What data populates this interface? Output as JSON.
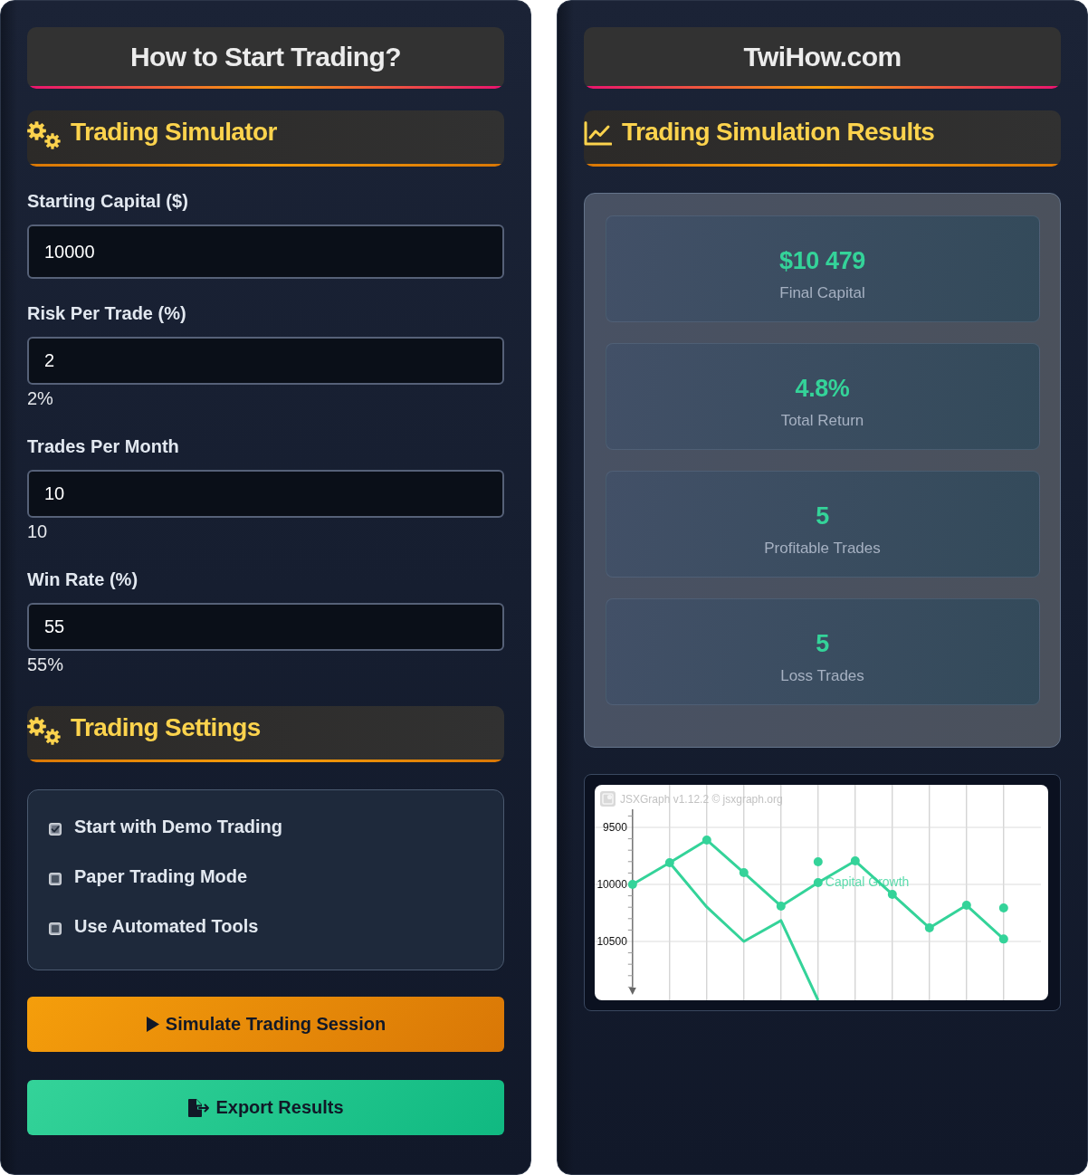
{
  "left_panel": {
    "header": {
      "title": "How to Start Trading?"
    },
    "simulator_section": {
      "title": "Trading Simulator"
    },
    "fields": [
      {
        "label": "Starting Capital ($)",
        "value": "10000"
      },
      {
        "label": "Risk Per Trade (%)",
        "value": "2",
        "reading": "2%"
      },
      {
        "label": "Trades Per Month",
        "value": "10",
        "reading": "10"
      },
      {
        "label": "Win Rate (%)",
        "value": "55",
        "reading": "55%"
      }
    ],
    "settings_section": {
      "title": "Trading Settings"
    },
    "options": [
      {
        "label": "Start with Demo Trading",
        "checked": true
      },
      {
        "label": "Paper Trading Mode",
        "checked": false
      },
      {
        "label": "Use Automated Tools",
        "checked": false
      }
    ],
    "buttons": [
      {
        "kind": "simulate",
        "label": "Simulate Trading Session"
      },
      {
        "kind": "export",
        "label": "Export Results"
      }
    ]
  },
  "right_panel": {
    "header": {
      "title": "TwiHow.com"
    },
    "results_section": {
      "title": "Trading Simulation Results"
    },
    "stats": [
      {
        "value": "$10 479",
        "label": "Final Capital"
      },
      {
        "value": "4.8%",
        "label": "Total Return"
      },
      {
        "value": "5",
        "label": "Profitable Trades"
      },
      {
        "value": "5",
        "label": "Loss Trades"
      }
    ],
    "chart": {
      "credit": "JSXGraph v1.12.2 © jsxgraph.org",
      "chart_data": {
        "type": "line",
        "grid": true,
        "categories": [
          null,
          null,
          null,
          null,
          null,
          null,
          null,
          null,
          null,
          null,
          null
        ],
        "ylim": [
          11016,
          9127
        ],
        "yticks": [
          9500,
          10000,
          10500
        ],
        "series": [
          {
            "name": "Capital Growth",
            "color": "#34d399",
            "marker": "o",
            "values": [
              10000,
              9810,
              9611,
              9897,
              10190,
              9984,
              9794,
              10087,
              10381,
              10183,
              10479
            ]
          },
          {
            "color": "#34d399",
            "values": [
              null,
              9810,
              10198,
              10500,
              10317,
              11016,
              null,
              null,
              null,
              null,
              null
            ]
          },
          {
            "type": "scatter",
            "color": "#34d399",
            "values": [
              null,
              null,
              null,
              null,
              null,
              9802,
              null,
              null,
              null,
              null,
              10206
            ]
          }
        ]
      }
    }
  }
}
